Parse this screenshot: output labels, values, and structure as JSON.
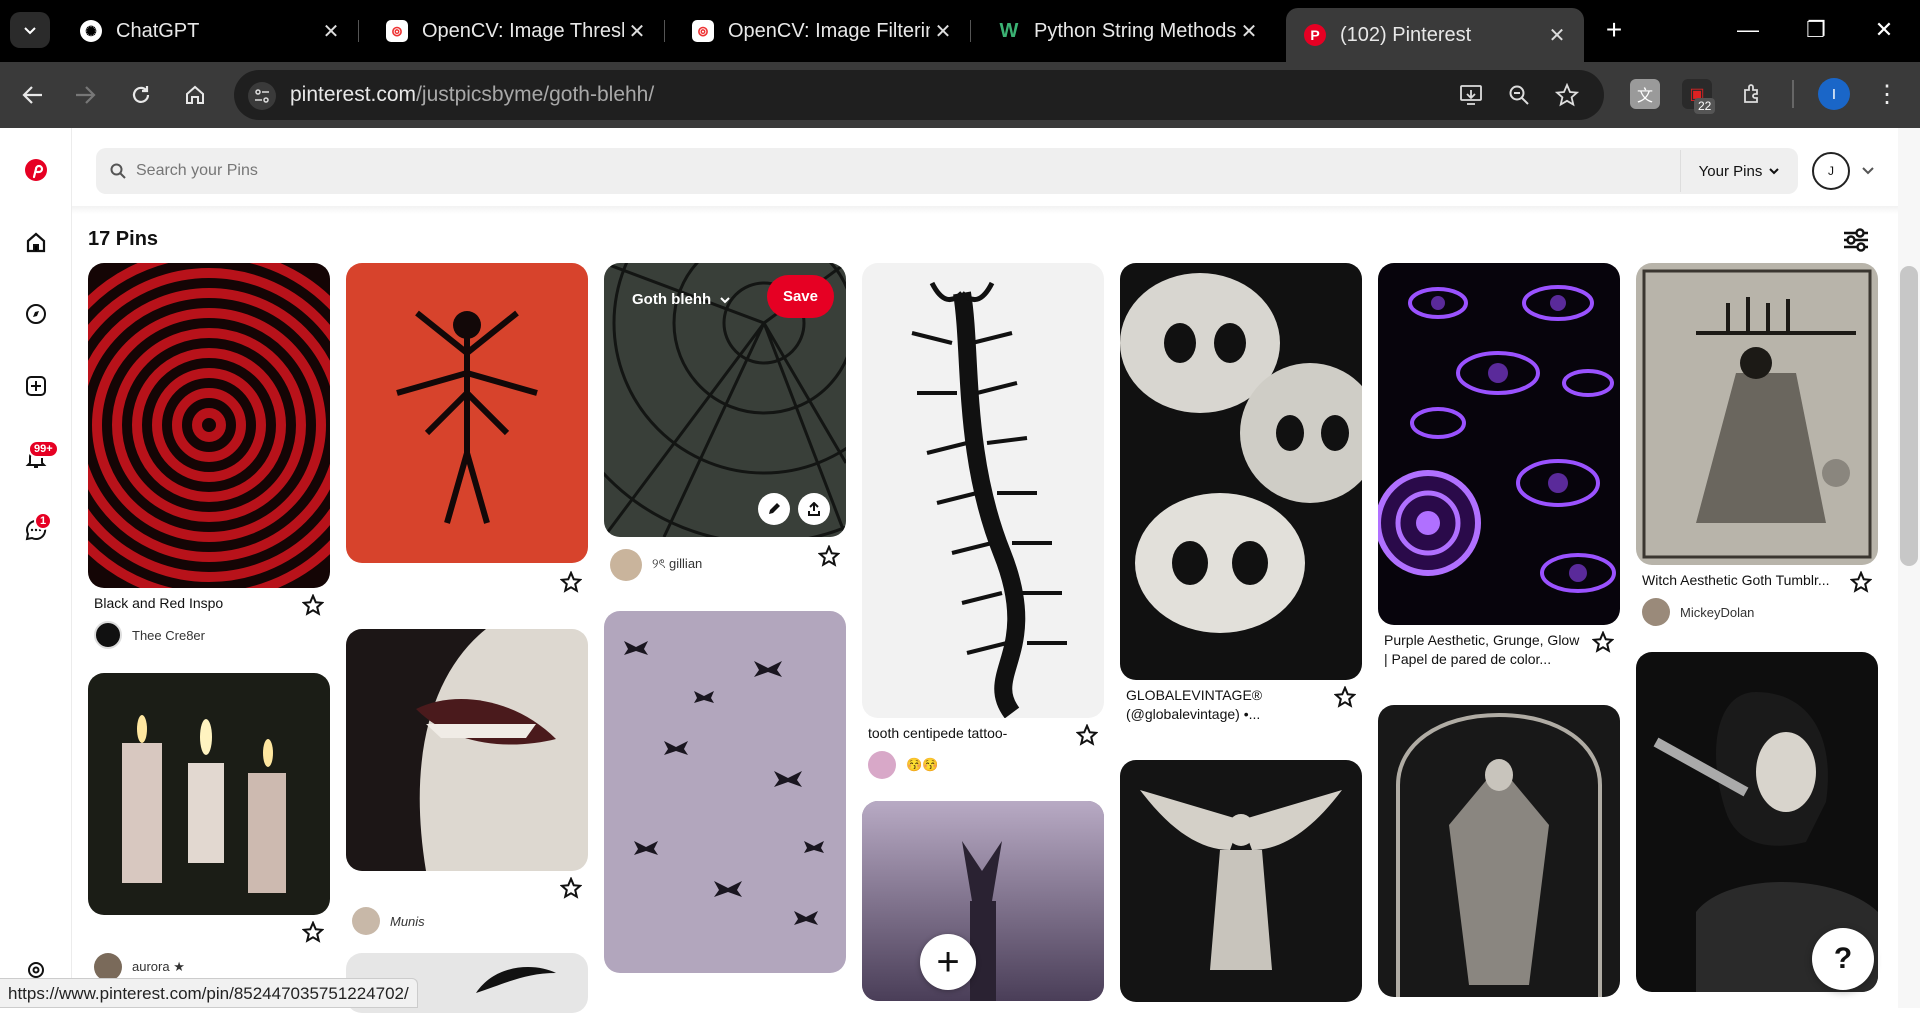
{
  "browser": {
    "tabs": [
      {
        "title": "ChatGPT",
        "active": false
      },
      {
        "title": "OpenCV: Image Threshol",
        "active": false
      },
      {
        "title": "OpenCV: Image Filtering",
        "active": false
      },
      {
        "title": "Python String Methods",
        "active": false
      },
      {
        "title": "(102) Pinterest",
        "active": true
      }
    ],
    "url_host": "pinterest.com",
    "url_path": "/justpicsbyme/goth-blehh/",
    "extension_badge": "22",
    "profile_initial": "I"
  },
  "pinterest": {
    "search_placeholder": "Search your Pins",
    "your_pins_label": "Your Pins",
    "account_initial": "J",
    "notifications_badge": "99+",
    "messages_badge": "1",
    "pin_count": "17 Pins",
    "save_label": "Save",
    "board_selector": "Goth blehh",
    "help_label": "?",
    "pins": {
      "black_red": {
        "title": "Black and Red Inspo",
        "creator": "Thee Cre8er"
      },
      "gillian": {
        "creator": "୨ৎ gillian"
      },
      "munis": {
        "creator": "Munis"
      },
      "centipede": {
        "title": "tooth centipede tattoo-",
        "creator": "😚😚"
      },
      "globale": {
        "title": "GLOBALEVINTAGE® (@globalevintage) •..."
      },
      "purple": {
        "title": "Purple Aesthetic, Grunge, Glow | Papel de pared de color..."
      },
      "witch": {
        "title": "Witch Aesthetic Goth Tumblr...",
        "creator": "MickeyDolan"
      },
      "candles": {
        "creator": "aurora ★"
      }
    }
  },
  "status_url": "https://www.pinterest.com/pin/852447035751224702/"
}
